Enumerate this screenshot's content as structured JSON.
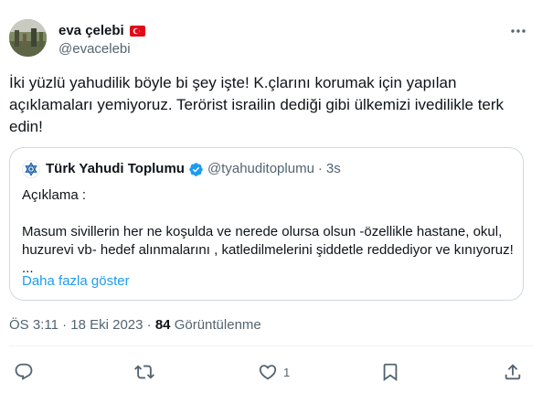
{
  "author": {
    "name": "eva çelebi",
    "handle": "@evacelebi",
    "flag_icon": "turkey-flag-icon"
  },
  "tweet": {
    "text": "İki yüzlü yahudilik böyle bi şey işte! K.çlarını korumak için yapılan açıklamaları yemiyoruz. Terörist israilin dediği gibi ülkemizi ivedilikle terk edin!"
  },
  "quote": {
    "name": "Türk Yahudi Toplumu",
    "verified_icon": "verified-badge-icon",
    "handle": "@tyahuditoplumu",
    "separator": "·",
    "time": "3s",
    "line1": "Açıklama :",
    "line2": "Masum sivillerin her ne koşulda ve nerede olursa olsun -özellikle hastane, okul, huzurevi vb- hedef alınmalarını , katledilmelerini şiddetle reddediyor ve kınıyoruz! ...",
    "show_more": "Daha fazla göster"
  },
  "meta": {
    "time": "ÖS 3:11",
    "separator": " · ",
    "date": "18 Eki 2023",
    "views_count": "84",
    "views_label": "Görüntülenme"
  },
  "actions": {
    "reply_icon": "reply-icon",
    "retweet_icon": "retweet-icon",
    "like_icon": "heart-icon",
    "like_count": "1",
    "bookmark_icon": "bookmark-icon",
    "share_icon": "share-icon"
  },
  "colors": {
    "text": "#0f1419",
    "secondary": "#536471",
    "link": "#1d9bf0",
    "border": "#cfd9de",
    "flag_red": "#e30a17"
  }
}
